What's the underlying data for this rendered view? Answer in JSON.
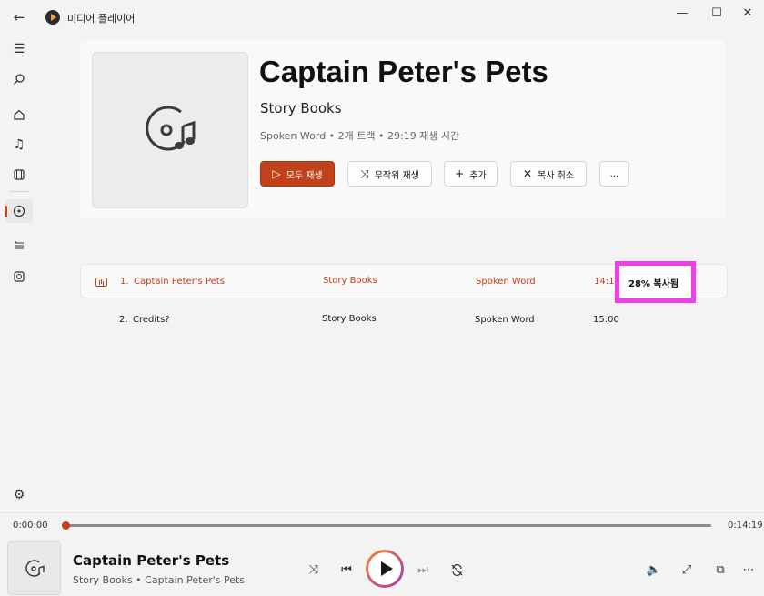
{
  "app": {
    "title": "미디어 플레이어"
  },
  "album": {
    "title": "Captain Peter's Pets",
    "artist": "Story Books",
    "meta": "Spoken Word • 2개 트랙 • 29:19 재생 시간"
  },
  "actions": {
    "play_all": "모두 재생",
    "shuffle": "무작위 재생",
    "add": "추가",
    "cancel_copy": "복사 취소",
    "more": "…"
  },
  "tracks": [
    {
      "number": "1.",
      "title": "Captain Peter's Pets",
      "artist": "Story Books",
      "genre": "Spoken Word",
      "duration": "14:19",
      "selected": true
    },
    {
      "number": "2.",
      "title": "Credits?",
      "artist": "Story Books",
      "genre": "Spoken Word",
      "duration": "15:00",
      "selected": false
    }
  ],
  "copy_status": "28% 복사됨",
  "player": {
    "elapsed": "0:00:00",
    "total": "0:14:19",
    "progress": 0,
    "now_playing_title": "Captain Peter's Pets",
    "now_playing_subtitle": "Story Books • Captain Peter's Pets"
  },
  "colors": {
    "accent": "#c0411a",
    "highlight": "#f03ee8"
  }
}
